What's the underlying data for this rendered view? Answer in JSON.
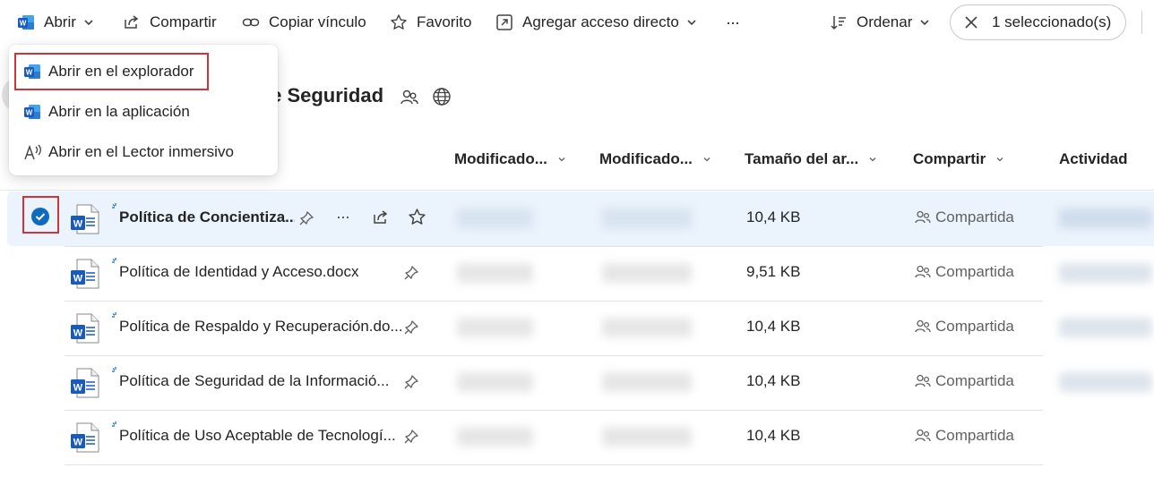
{
  "toolbar": {
    "open_label": "Abrir",
    "share_label": "Compartir",
    "copy_link_label": "Copiar vínculo",
    "favorite_label": "Favorito",
    "add_shortcut_label": "Agregar acceso directo",
    "more_label": "···",
    "sort_label": "Ordenar",
    "selection_label": "1 seleccionado(s)"
  },
  "open_menu": {
    "items": [
      {
        "label": "Abrir en el explorador",
        "icon": "word-icon"
      },
      {
        "label": "Abrir en la aplicación",
        "icon": "word-icon"
      },
      {
        "label": "Abrir en el Lector inmersivo",
        "icon": "immersive-reader-icon"
      }
    ]
  },
  "library": {
    "title_visible": "le Seguridad"
  },
  "columns": {
    "modified": "Modificado...",
    "modified_by": "Modificado...",
    "file_size": "Tamaño del ar...",
    "sharing": "Compartir",
    "activity": "Actividad"
  },
  "files": [
    {
      "name": "Política de Concientiza...",
      "size": "10,4 KB",
      "sharing": "Compartida",
      "selected": true
    },
    {
      "name": "Política de Identidad y Acceso.docx",
      "size": "9,51 KB",
      "sharing": "Compartida",
      "selected": false
    },
    {
      "name": "Política de Respaldo y Recuperación.do...",
      "size": "10,4 KB",
      "sharing": "Compartida",
      "selected": false
    },
    {
      "name": "Política de Seguridad de la Informació...",
      "size": "10,4 KB",
      "sharing": "Compartida",
      "selected": false
    },
    {
      "name": "Política de Uso Aceptable de Tecnologí...",
      "size": "10,4 KB",
      "sharing": "Compartida",
      "selected": false
    }
  ],
  "colors": {
    "accent": "#0f6cbd",
    "word_blue": "#185abd",
    "highlight_red": "#d13438",
    "selected_row": "#ebf3fc"
  }
}
